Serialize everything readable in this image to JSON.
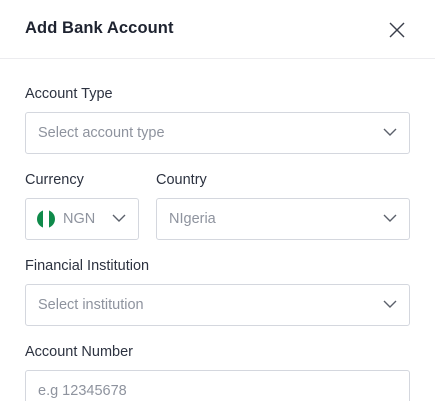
{
  "modal": {
    "title": "Add Bank Account"
  },
  "form": {
    "account_type": {
      "label": "Account Type",
      "placeholder": "Select account type"
    },
    "currency": {
      "label": "Currency",
      "value": "NGN",
      "flag_colors": [
        "#0f8a4a",
        "#ffffff",
        "#0f8a4a"
      ]
    },
    "country": {
      "label": "Country",
      "value": "NIgeria"
    },
    "institution": {
      "label": "Financial Institution",
      "placeholder": "Select institution"
    },
    "account_number": {
      "label": "Account Number",
      "placeholder": "e.g 12345678"
    }
  },
  "colors": {
    "border": "#d4d7de",
    "placeholder": "#8e939e",
    "label": "#2c3240",
    "title": "#1e2330"
  }
}
